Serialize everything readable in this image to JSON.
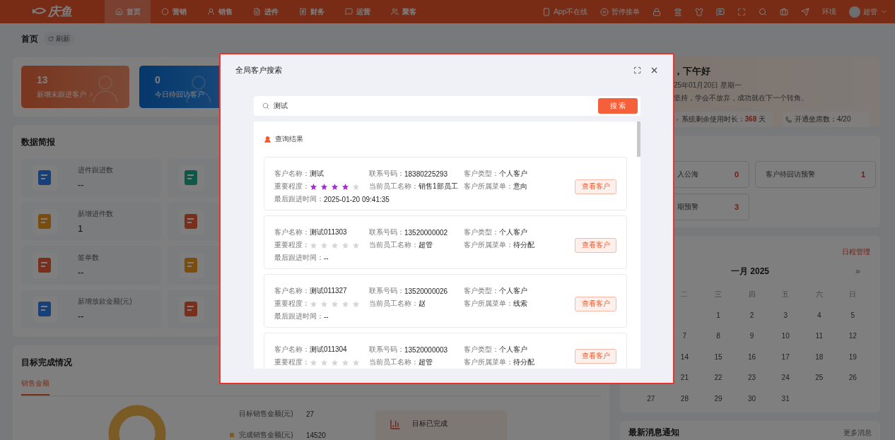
{
  "nav": {
    "logo": "庆鱼",
    "tabs": [
      {
        "label": "首页",
        "selected": true
      },
      {
        "label": "营销",
        "selected": false
      },
      {
        "label": "销售",
        "selected": false
      },
      {
        "label": "进件",
        "selected": false
      },
      {
        "label": "财务",
        "selected": false
      },
      {
        "label": "运营",
        "selected": false
      },
      {
        "label": "聚客",
        "selected": false
      }
    ],
    "status": [
      "App不在线",
      "暂停接单"
    ],
    "env": "环境",
    "user": "超管"
  },
  "page": {
    "title": "首页",
    "refresh": "刷新"
  },
  "summary_cards": [
    {
      "value": "13",
      "label": "新增未跟进客户"
    },
    {
      "value": "0",
      "label": "今日待回访客户"
    }
  ],
  "brief": {
    "title": "数据简报",
    "items": [
      {
        "label": "进件跟进数",
        "value": "--"
      },
      {
        "label": "新增进件数",
        "value": "1"
      },
      {
        "label": "签单数",
        "value": "--"
      },
      {
        "label": "新增放款金额(元)",
        "value": "--"
      }
    ]
  },
  "goal": {
    "title": "目标完成情况",
    "tabs": [
      {
        "label": "销售金额",
        "selected": true
      }
    ],
    "stats": [
      {
        "label": "目标销售金额(元)",
        "value": "27"
      },
      {
        "label": "完成销售金额(元)",
        "value": "14520"
      }
    ],
    "done_label": "目标已完成"
  },
  "greeting": {
    "title": "，下午好",
    "date": "25年01月20日 星期一",
    "motto": "坚持，学会不放弃，成功就在下一个转角。",
    "pills": [
      {
        "label": "系统剩余使用时长：",
        "highlight": "368",
        "suffix": " 天"
      },
      {
        "label": "开通坐席数：4/20"
      }
    ]
  },
  "warnings": [
    {
      "label": "入公海",
      "count": "0"
    },
    {
      "label": "客户待回访预警",
      "count": "1"
    },
    {
      "label": "期预警",
      "count": "3"
    }
  ],
  "calendar": {
    "link": "日程管理",
    "month": "一月 2025",
    "next": "»",
    "weekdays": [
      "二",
      "三",
      "四",
      "五",
      "六",
      "日"
    ],
    "weeks": [
      [
        "1",
        "2",
        "3",
        "4",
        "5"
      ],
      [
        "7",
        "8",
        "9",
        "10",
        "11",
        "12"
      ],
      [
        "14",
        "15",
        "16",
        "17",
        "18",
        "19"
      ],
      [
        "21",
        "22",
        "23",
        "24",
        "25",
        "26"
      ],
      [
        "27",
        "28",
        "29",
        "30",
        "31"
      ]
    ]
  },
  "news": {
    "title": "最新消息通知",
    "more": "更多消息"
  },
  "search_modal": {
    "title": "全局客户搜索",
    "query": "测试",
    "button": "搜 索",
    "results_title": "查询结果",
    "results": [
      {
        "button": "查看客户",
        "rows": [
          [
            {
              "kind": "text",
              "label": "客户名称：",
              "value": "测试"
            },
            {
              "kind": "text",
              "label": "联系号码：",
              "value": "18380225293"
            },
            {
              "kind": "text",
              "label": "客户类型：",
              "value": "个人客户"
            }
          ],
          [
            {
              "kind": "stars",
              "label": "重要程度：",
              "stars": 4
            },
            {
              "kind": "text",
              "label": "当前员工名称：",
              "value": "销售1部员工"
            },
            {
              "kind": "text",
              "label": "客户所属菜单：",
              "value": "意向"
            }
          ],
          [
            {
              "kind": "text",
              "label": "最后跟进时间：",
              "value": "2025-01-20 09:41:35"
            }
          ]
        ]
      },
      {
        "button": "查看客户",
        "rows": [
          [
            {
              "kind": "text",
              "label": "客户名称：",
              "value": "测试011303"
            },
            {
              "kind": "text",
              "label": "联系号码：",
              "value": "13520000002"
            },
            {
              "kind": "text",
              "label": "客户类型：",
              "value": "个人客户"
            }
          ],
          [
            {
              "kind": "stars",
              "label": "重要程度：",
              "stars": 0
            },
            {
              "kind": "text",
              "label": "当前员工名称：",
              "value": "超管"
            },
            {
              "kind": "text",
              "label": "客户所属菜单：",
              "value": "待分配"
            }
          ],
          [
            {
              "kind": "text",
              "label": "最后跟进时间：",
              "value": "--"
            }
          ]
        ]
      },
      {
        "button": "查看客户",
        "rows": [
          [
            {
              "kind": "text",
              "label": "客户名称：",
              "value": "测试011327"
            },
            {
              "kind": "text",
              "label": "联系号码：",
              "value": "13520000026"
            },
            {
              "kind": "text",
              "label": "客户类型：",
              "value": "个人客户"
            }
          ],
          [
            {
              "kind": "stars",
              "label": "重要程度：",
              "stars": 0
            },
            {
              "kind": "text",
              "label": "当前员工名称：",
              "value": "赵"
            },
            {
              "kind": "text",
              "label": "客户所属菜单：",
              "value": "线索"
            }
          ],
          [
            {
              "kind": "text",
              "label": "最后跟进时间：",
              "value": "--"
            }
          ]
        ]
      },
      {
        "button": "查看客户",
        "rows": [
          [
            {
              "kind": "text",
              "label": "客户名称：",
              "value": "测试011304"
            },
            {
              "kind": "text",
              "label": "联系号码：",
              "value": "13520000003"
            },
            {
              "kind": "text",
              "label": "客户类型：",
              "value": "个人客户"
            }
          ],
          [
            {
              "kind": "stars",
              "label": "重要程度：",
              "stars": 0
            },
            {
              "kind": "text",
              "label": "当前员工名称：",
              "value": "超管"
            },
            {
              "kind": "text",
              "label": "客户所属菜单：",
              "value": "待分配"
            }
          ]
        ]
      }
    ]
  }
}
